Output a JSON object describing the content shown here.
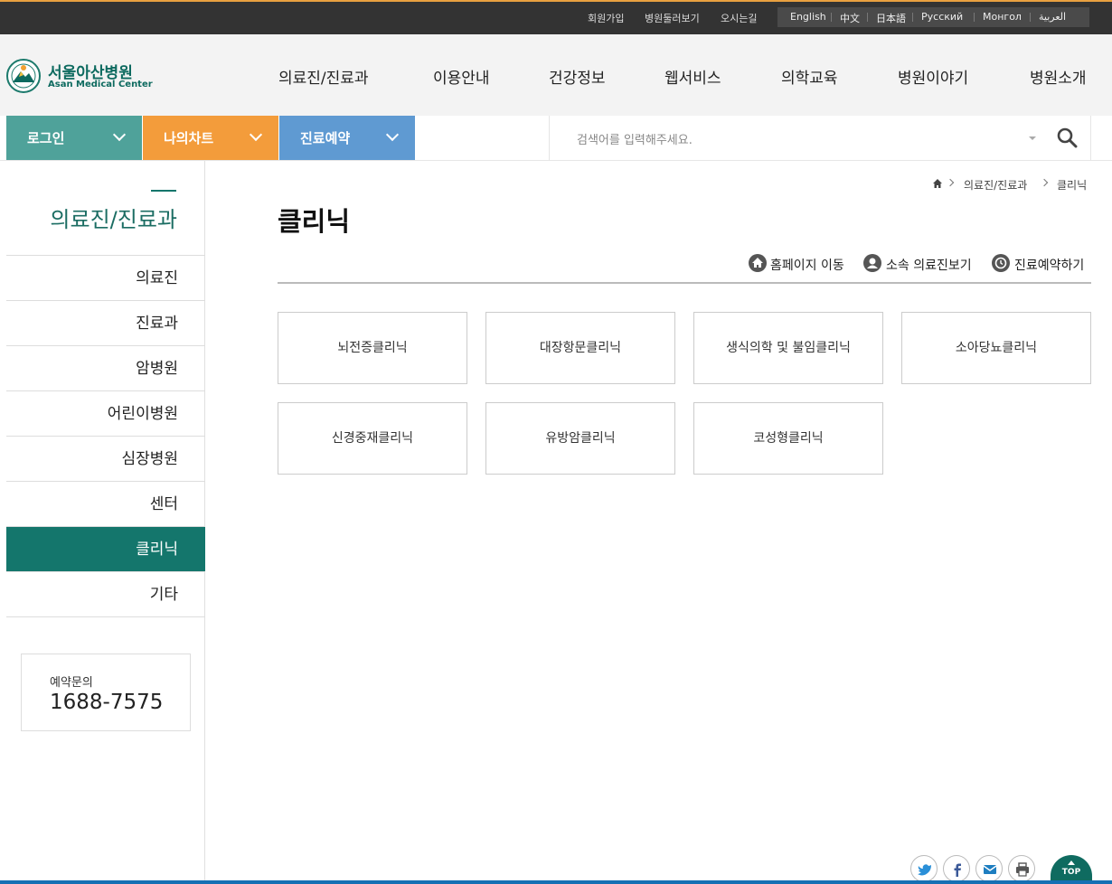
{
  "util_links": [
    "회원가입",
    "병원둘러보기",
    "오시는길"
  ],
  "languages": [
    "English",
    "中文",
    "日本語",
    "Русский",
    "Монгол",
    "العربية"
  ],
  "logo": {
    "korean": "서울아산병원",
    "english": "Asan Medical Center"
  },
  "gnb": [
    "의료진/진료과",
    "이용안내",
    "건강정보",
    "웹서비스",
    "의학교육",
    "병원이야기",
    "병원소개"
  ],
  "actions": {
    "login": "로그인",
    "my_chart": "나의차트",
    "reservation": "진료예약"
  },
  "search": {
    "placeholder": "검색어를 입력해주세요."
  },
  "sidebar": {
    "title": "의료진/진료과",
    "items": [
      "의료진",
      "진료과",
      "암병원",
      "어린이병원",
      "심장병원",
      "센터",
      "클리닉",
      "기타"
    ],
    "active_item": "클리닉",
    "reservation_label": "예약문의",
    "reservation_phone": "1688-7575"
  },
  "breadcrumb": [
    "의료진/진료과",
    "클리닉"
  ],
  "page_title": "클리닉",
  "tools": {
    "homepage": "홈페이지 이동",
    "doctors": "소속 의료진보기",
    "reserve": "진료예약하기"
  },
  "clinics": [
    "뇌전증클리닉",
    "대장항문클리닉",
    "생식의학 및 불임클리닉",
    "소아당뇨클리닉",
    "신경중재클리닉",
    "유방암클리닉",
    "코성형클리닉"
  ],
  "top_button": "TOP",
  "colors": {
    "accent_teal": "#14766c",
    "login_bg": "#4fa29a",
    "mychart_bg": "#f39c3b",
    "reserve_bg": "#5f9ad2"
  }
}
